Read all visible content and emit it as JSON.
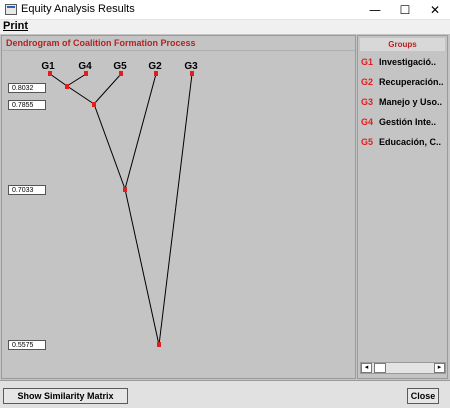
{
  "window": {
    "title": "Equity Analysis Results",
    "minimize_glyph": "—",
    "maximize_glyph": "☐",
    "close_glyph": "✕"
  },
  "menu": {
    "print": "Print"
  },
  "dendrogram": {
    "title": "Dendrogram of Coalition Formation Process",
    "leaves": [
      "G1",
      "G4",
      "G5",
      "G2",
      "G3"
    ],
    "levels": [
      "0.8032",
      "0.7855",
      "0.7033",
      "0.5575"
    ],
    "merges": [
      {
        "children": [
          "G1",
          "G4"
        ],
        "level": 0.8032
      },
      {
        "children": [
          "G1+G4",
          "G5"
        ],
        "level": 0.7855
      },
      {
        "children": [
          "G1+G4+G5",
          "G2"
        ],
        "level": 0.7033
      },
      {
        "children": [
          "G1+G4+G5+G2",
          "G3"
        ],
        "level": 0.5575
      }
    ],
    "node_color": "#e21d1d",
    "line_color": "#000000"
  },
  "groups": {
    "header": "Groups",
    "items": [
      {
        "code": "G1",
        "name": "Investigació.."
      },
      {
        "code": "G2",
        "name": "Recuperación.."
      },
      {
        "code": "G3",
        "name": "Manejo y Uso.."
      },
      {
        "code": "G4",
        "name": "Gestión Inte.."
      },
      {
        "code": "G5",
        "name": "Educación, C.."
      }
    ],
    "scroll_left": "◂",
    "scroll_right": "▸"
  },
  "buttons": {
    "similarity": "Show Similarity Matrix",
    "close": "Close"
  },
  "colors": {
    "accent_red": "#b32323",
    "code_red": "#e21d1d",
    "panel_gray": "#c4c4c4"
  }
}
